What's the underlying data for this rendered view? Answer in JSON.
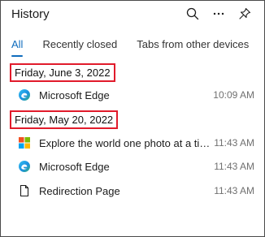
{
  "header": {
    "title": "History",
    "actions": [
      {
        "name": "search-icon"
      },
      {
        "name": "more-options-icon"
      },
      {
        "name": "pin-icon"
      }
    ]
  },
  "tabs": [
    {
      "label": "All",
      "active": true
    },
    {
      "label": "Recently closed",
      "active": false
    },
    {
      "label": "Tabs from other devices",
      "active": false
    }
  ],
  "groups": [
    {
      "date": "Friday, June 3, 2022",
      "items": [
        {
          "icon": "edge-icon",
          "title": "Microsoft Edge",
          "time": "10:09 AM"
        }
      ]
    },
    {
      "date": "Friday, May 20, 2022",
      "items": [
        {
          "icon": "microsoft-logo-icon",
          "title": "Explore the world one photo at a time | Bin...",
          "time": "11:43 AM"
        },
        {
          "icon": "edge-icon",
          "title": "Microsoft Edge",
          "time": "11:43 AM"
        },
        {
          "icon": "page-icon",
          "title": "Redirection Page",
          "time": "11:43 AM"
        }
      ]
    }
  ],
  "colors": {
    "accent": "#0f6cbd",
    "highlight_border": "#e11b2b"
  }
}
